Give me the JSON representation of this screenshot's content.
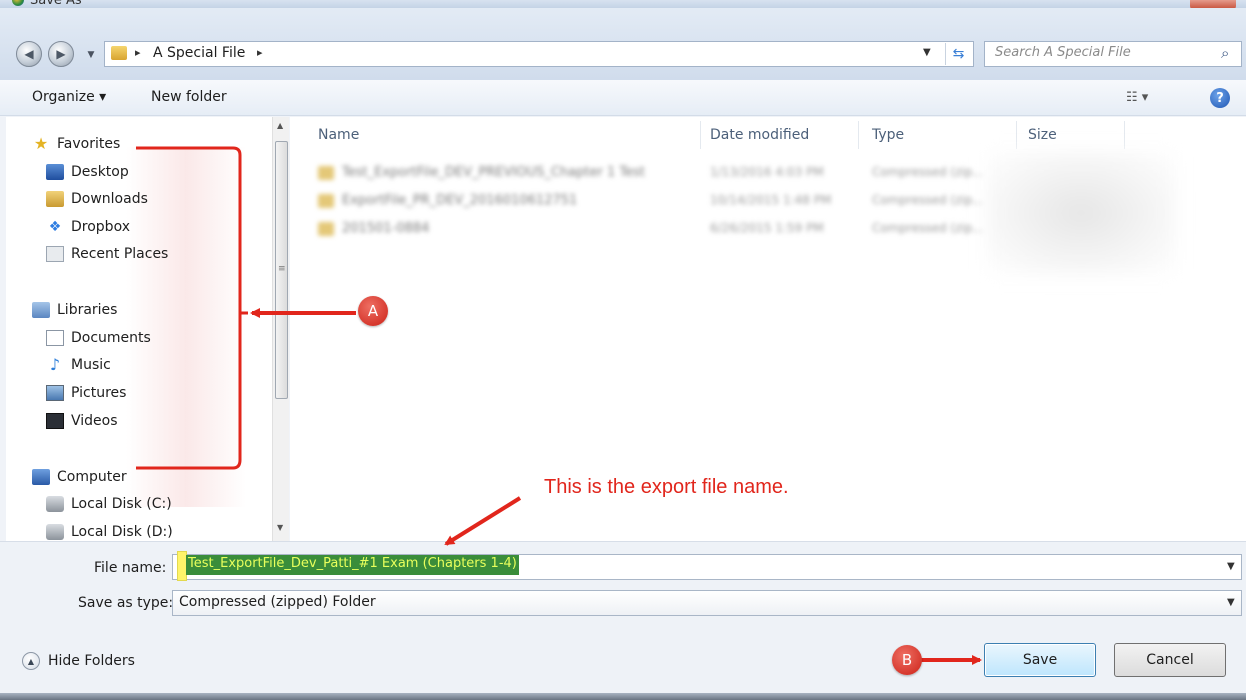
{
  "window": {
    "title": "Save As"
  },
  "address": {
    "crumb": "A Special File",
    "separator": "▸"
  },
  "search": {
    "placeholder": "Search A Special File"
  },
  "toolbar": {
    "organize": "Organize ▾",
    "new_folder": "New folder",
    "views": "☷ ▾",
    "help": "?"
  },
  "sidebar": {
    "favorites": {
      "label": "Favorites",
      "items": [
        "Desktop",
        "Downloads",
        "Dropbox",
        "Recent Places"
      ]
    },
    "libraries": {
      "label": "Libraries",
      "items": [
        "Documents",
        "Music",
        "Pictures",
        "Videos"
      ]
    },
    "computer": {
      "label": "Computer",
      "items": [
        "Local Disk (C:)",
        "Local Disk (D:)"
      ]
    }
  },
  "file_list": {
    "columns": [
      "Name",
      "Date modified",
      "Type",
      "Size"
    ],
    "rows": [
      {
        "name": "Test_ExportFile_DEV_PREVIOUS_Chapter 1 Test",
        "date": "1/13/2016 4:03 PM",
        "type": "Compressed (zip..."
      },
      {
        "name": "ExportFile_PR_DEV_2016010612751",
        "date": "10/14/2015 1:48 PM",
        "type": "Compressed (zip..."
      },
      {
        "name": "201501-0884",
        "date": "6/26/2015 1:59 PM",
        "type": "Compressed (zip..."
      }
    ]
  },
  "form": {
    "file_name_label": "File name:",
    "file_name_value": "Test_ExportFile_Dev_Patti_#1 Exam (Chapters 1-4)",
    "save_as_type_label": "Save as type:",
    "save_as_type_value": "Compressed (zipped) Folder"
  },
  "buttons": {
    "hide_folders": "Hide Folders",
    "save": "Save",
    "cancel": "Cancel"
  },
  "annotations": {
    "marker_a": "A",
    "marker_b": "B",
    "callout_text": "This is the export file name.",
    "color": "#e1261c"
  },
  "colors": {
    "highlight": "#fff46a",
    "selection": "#3a8d3a"
  }
}
